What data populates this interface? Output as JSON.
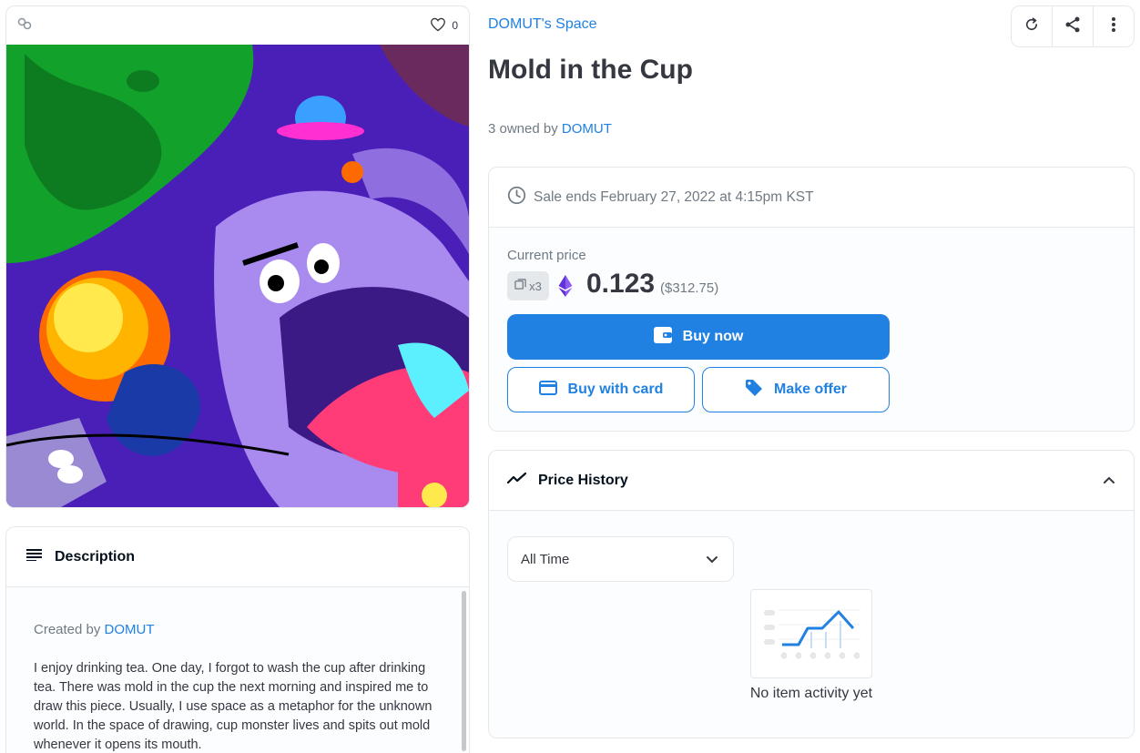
{
  "image_card": {
    "likes": "0"
  },
  "description": {
    "heading": "Description",
    "created_prefix": "Created by",
    "creator": "DOMUT",
    "text": "I enjoy drinking tea. One day, I forgot to wash the cup after drinking tea. There was mold in the cup the next morning and inspired me to draw this piece. Usually, I use space as a metaphor for the unknown world. In the space of drawing, cup monster lives and spits out mold whenever it opens its mouth."
  },
  "collection": "DOMUT's Space",
  "title": "Mold in the Cup",
  "ownership": {
    "prefix": "3 owned by",
    "owner": "DOMUT"
  },
  "sale": {
    "ends": "Sale ends February 27, 2022 at 4:15pm KST",
    "current_label": "Current price",
    "quantity": "x3",
    "price": "0.123",
    "usd": "($312.75)",
    "buy_now": "Buy now",
    "buy_card": "Buy with card",
    "make_offer": "Make offer"
  },
  "price_history": {
    "heading": "Price History",
    "filter": "All Time",
    "empty": "No item activity yet"
  },
  "colors": {
    "accent": "#2081e2",
    "text": "#353840",
    "muted": "#707a83",
    "border": "#e5e8eb"
  },
  "icons": [
    "link-icon",
    "heart-icon",
    "refresh-icon",
    "share-icon",
    "more-icon",
    "clock-icon",
    "copies-icon",
    "eth-icon",
    "wallet-icon",
    "card-icon",
    "tag-icon",
    "trend-icon",
    "chevron-up-icon",
    "chevron-down-icon",
    "lines-icon"
  ]
}
